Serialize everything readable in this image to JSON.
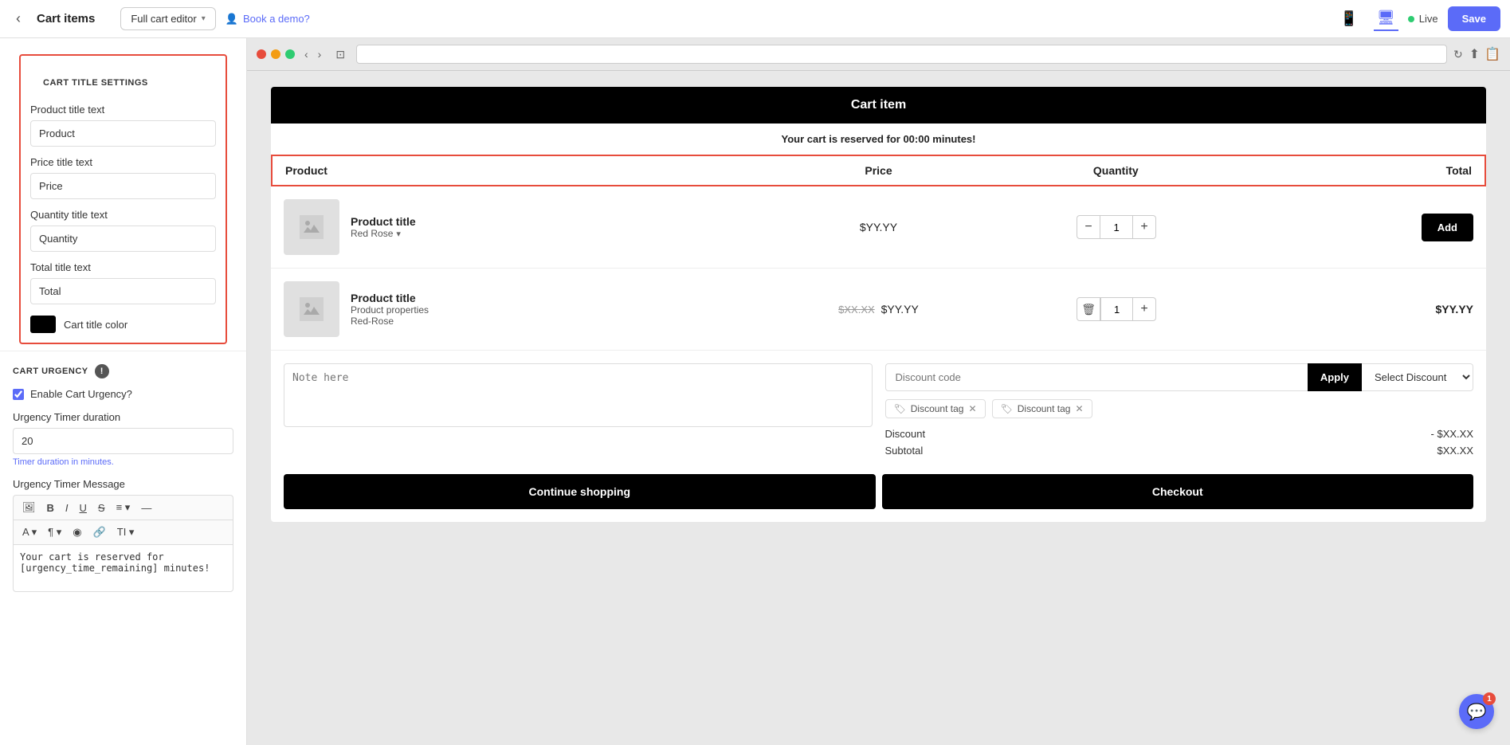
{
  "topbar": {
    "back_label": "‹",
    "title": "Cart items",
    "dropdown_label": "Full cart editor",
    "book_demo_label": "Book a demo?",
    "live_label": "Live",
    "save_label": "Save"
  },
  "browser": {
    "url_placeholder": ""
  },
  "sidebar": {
    "cart_title_settings_label": "CART TITLE SETTINGS",
    "product_title_label": "Product title text",
    "product_title_value": "Product",
    "price_title_label": "Price title text",
    "price_title_value": "Price",
    "quantity_title_label": "Quantity title text",
    "quantity_title_value": "Quantity",
    "total_title_label": "Total title text",
    "total_title_value": "Total",
    "cart_title_color_label": "Cart title color",
    "cart_urgency_label": "CART URGENCY",
    "enable_urgency_label": "Enable Cart Urgency?",
    "urgency_timer_label": "Urgency Timer duration",
    "urgency_timer_value": "20",
    "timer_helper": "Timer duration in minutes.",
    "urgency_message_label": "Urgency Timer Message",
    "urgency_message_text": "Your cart is reserved for [urgency_time_remaining] minutes!"
  },
  "cart": {
    "header": "Cart item",
    "reserved_text": "Your cart is reserved for 00:00 minutes!",
    "columns": {
      "product": "Product",
      "price": "Price",
      "quantity": "Quantity",
      "total": "Total"
    },
    "items": [
      {
        "name": "Product title",
        "variant": "Red Rose",
        "has_dropdown": true,
        "price": "$YY.YY",
        "qty": "1",
        "total": "",
        "has_add_btn": true,
        "add_label": "Add",
        "strikethrough": false
      },
      {
        "name": "Product title",
        "variant": "Product properties",
        "variant2": "Red-Rose",
        "price_strikethrough": "$XX.XX",
        "price": "$YY.YY",
        "qty": "1",
        "total": "$YY.YY",
        "has_add_btn": false,
        "strikethrough": true
      }
    ],
    "note_placeholder": "Note here",
    "discount_placeholder": "Discount code",
    "apply_label": "Apply",
    "select_discount_label": "Select Discount",
    "discount_tags": [
      {
        "label": "Discount tag"
      },
      {
        "label": "Discount tag"
      }
    ],
    "discount_label": "Discount",
    "discount_amount": "- $XX.XX",
    "subtotal_label": "Subtotal",
    "subtotal_amount": "$XX.XX",
    "continue_label": "Continue shopping",
    "checkout_label": "Checkout"
  },
  "chat": {
    "badge": "1"
  }
}
